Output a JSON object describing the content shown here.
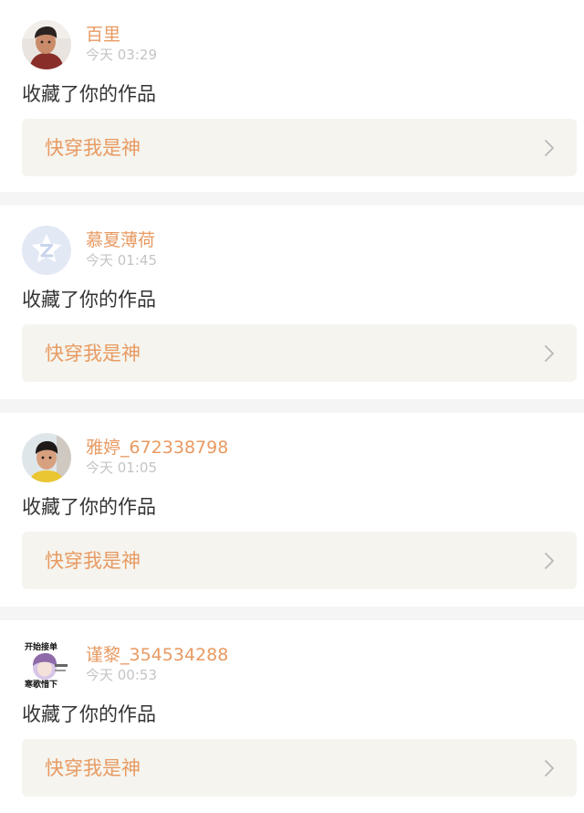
{
  "notifications": [
    {
      "username": "百里",
      "time": "今天 03:29",
      "action": "收藏了你的作品",
      "work_title": "快穿我是神",
      "avatar": "avatar-photo-boy"
    },
    {
      "username": "慕夏薄荷",
      "time": "今天 01:45",
      "action": "收藏了你的作品",
      "work_title": "快穿我是神",
      "avatar": "avatar-default-z"
    },
    {
      "username": "雅婷_672338798",
      "time": "今天 01:05",
      "action": "收藏了你的作品",
      "work_title": "快穿我是神",
      "avatar": "avatar-photo-child"
    },
    {
      "username": "谨黎_354534288",
      "time": "今天 00:53",
      "action": "收藏了你的作品",
      "work_title": "快穿我是神",
      "avatar": "avatar-sticker-image",
      "avatar_text_top": "开始接单",
      "avatar_text_bottom": "寒歌惜下"
    }
  ],
  "colors": {
    "accent": "#e89a62",
    "timestamp": "#c4c4c4",
    "card_link_bg": "#f5f4ee",
    "separator": "#f5f5f5"
  }
}
